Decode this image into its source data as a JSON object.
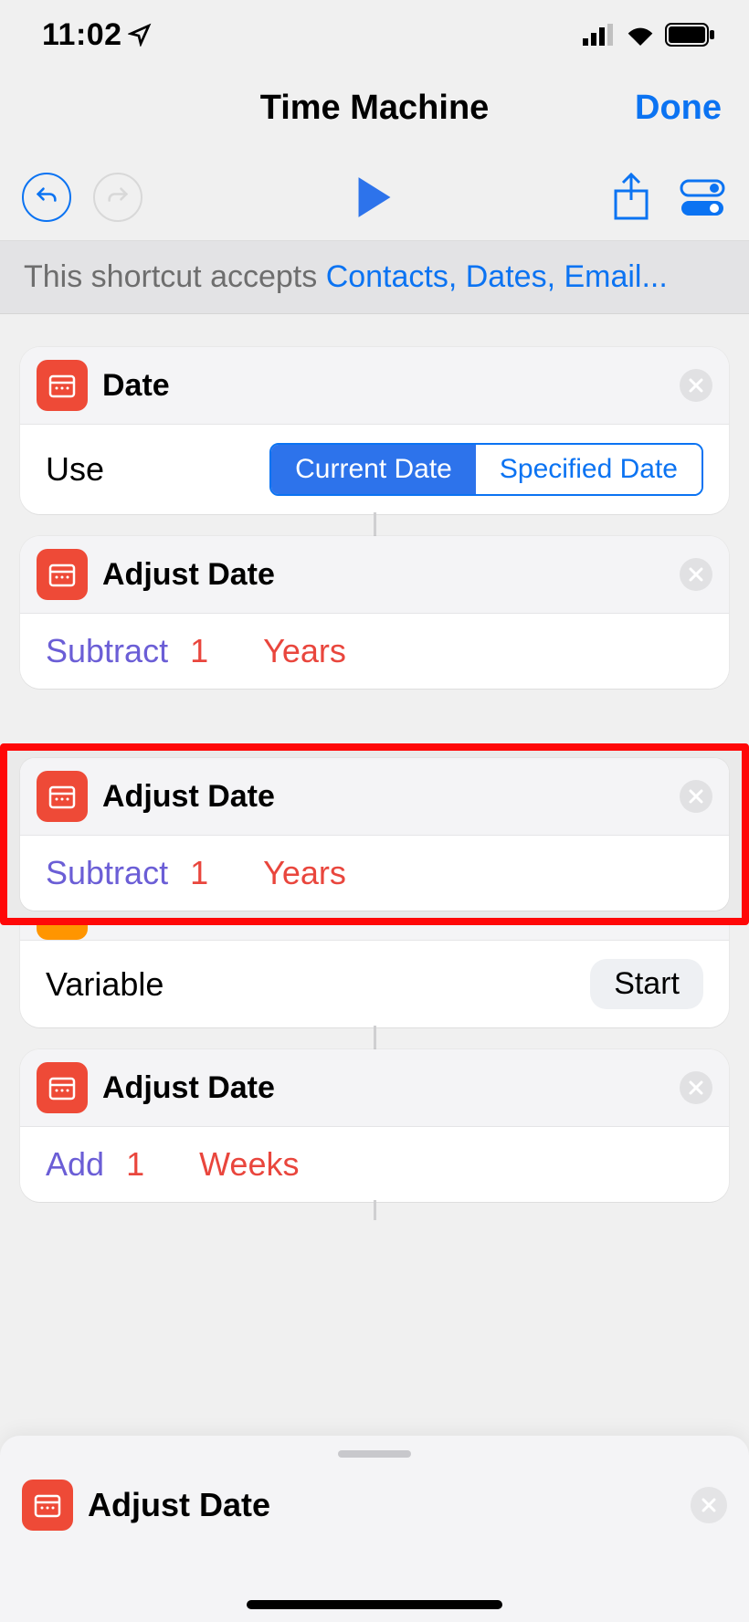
{
  "status": {
    "time": "11:02"
  },
  "nav": {
    "title": "Time Machine",
    "done": "Done"
  },
  "accepts": {
    "label": "This shortcut accepts ",
    "types": "Contacts, Dates, Email..."
  },
  "actions": {
    "date": {
      "title": "Date",
      "use_label": "Use",
      "segment_active": "Current Date",
      "segment_inactive": "Specified Date"
    },
    "adjust1": {
      "title": "Adjust Date",
      "op": "Subtract",
      "value": "1",
      "unit": "Years"
    },
    "adjust_highlight": {
      "title": "Adjust Date",
      "op": "Subtract",
      "value": "1",
      "unit": "Years"
    },
    "variable": {
      "label": "Variable",
      "pill": "Start"
    },
    "adjust3": {
      "title": "Adjust Date",
      "op": "Add",
      "value": "1",
      "unit": "Weeks"
    },
    "sheet": {
      "title": "Adjust Date"
    }
  }
}
